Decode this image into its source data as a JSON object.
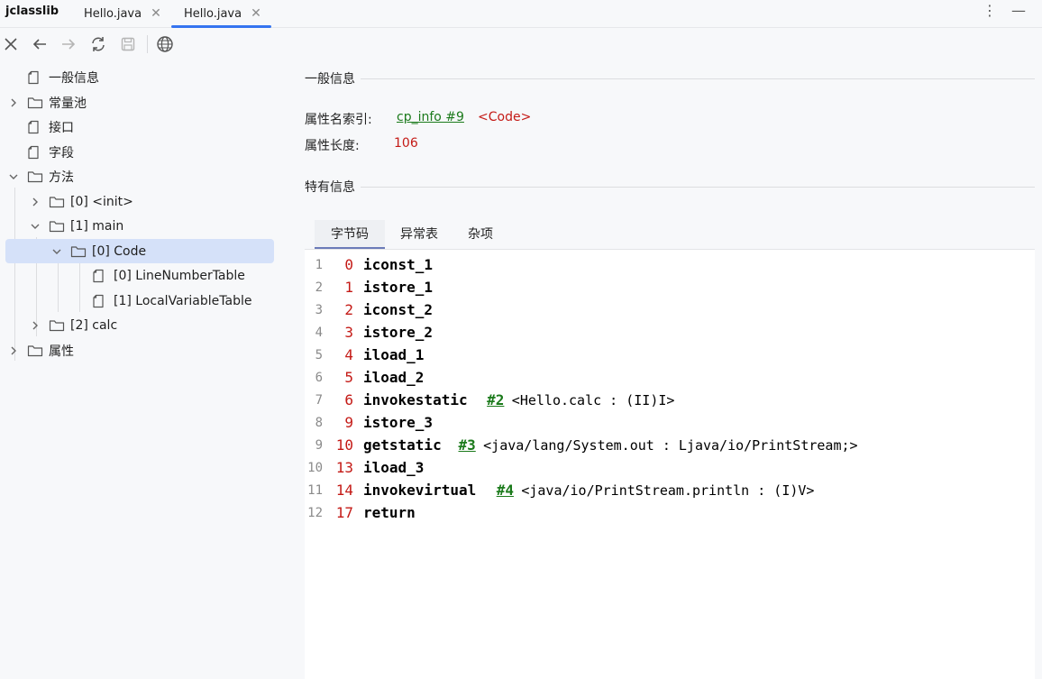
{
  "app": {
    "name": "jclasslib"
  },
  "tabs": [
    {
      "label": "Hello.java",
      "active": false
    },
    {
      "label": "Hello.java",
      "active": true
    }
  ],
  "tab_close_glyph": "✕",
  "window_controls": {
    "more": "⋮",
    "minimize": "—"
  },
  "toolbar": {
    "icons": [
      "close-icon",
      "back-arrow-icon",
      "forward-arrow-icon",
      "refresh-icon",
      "save-icon",
      "globe-icon"
    ]
  },
  "tree": {
    "items": [
      {
        "label": "一般信息",
        "icon": "file-icon"
      },
      {
        "label": "常量池",
        "icon": "folder-icon",
        "state": "collapsed"
      },
      {
        "label": "接口",
        "icon": "file-icon"
      },
      {
        "label": "字段",
        "icon": "file-icon"
      },
      {
        "label": "方法",
        "icon": "folder-icon",
        "state": "expanded"
      },
      {
        "label": "[0] <init>",
        "icon": "folder-icon",
        "state": "collapsed"
      },
      {
        "label": "[1] main",
        "icon": "folder-icon",
        "state": "expanded"
      },
      {
        "label": "[0] Code",
        "icon": "folder-icon",
        "state": "expanded",
        "selected": true
      },
      {
        "label": "[0] LineNumberTable",
        "icon": "file-icon"
      },
      {
        "label": "[1] LocalVariableTable",
        "icon": "file-icon"
      },
      {
        "label": "[2] calc",
        "icon": "folder-icon",
        "state": "collapsed"
      },
      {
        "label": "属性",
        "icon": "folder-icon",
        "state": "collapsed"
      }
    ]
  },
  "general": {
    "title": "一般信息",
    "name_index_label": "属性名索引:",
    "name_index_link": "cp_info #9",
    "name_index_value": "<Code>",
    "length_label": "属性长度:",
    "length_value": "106"
  },
  "specific": {
    "title": "特有信息"
  },
  "subtabs": [
    {
      "label": "字节码",
      "active": true
    },
    {
      "label": "异常表",
      "active": false
    },
    {
      "label": "杂项",
      "active": false
    }
  ],
  "bytecode": [
    {
      "line": "1",
      "offset": "0",
      "op": "iconst_1"
    },
    {
      "line": "2",
      "offset": "1",
      "op": "istore_1"
    },
    {
      "line": "3",
      "offset": "2",
      "op": "iconst_2"
    },
    {
      "line": "4",
      "offset": "3",
      "op": "istore_2"
    },
    {
      "line": "5",
      "offset": "4",
      "op": "iload_1"
    },
    {
      "line": "6",
      "offset": "5",
      "op": "iload_2"
    },
    {
      "line": "7",
      "offset": "6",
      "op": "invokestatic",
      "ref": "#2",
      "comment": "<Hello.calc : (II)I>"
    },
    {
      "line": "8",
      "offset": "9",
      "op": "istore_3"
    },
    {
      "line": "9",
      "offset": "10",
      "op": "getstatic",
      "ref": "#3",
      "comment": "<java/lang/System.out : Ljava/io/PrintStream;>"
    },
    {
      "line": "10",
      "offset": "13",
      "op": "iload_3"
    },
    {
      "line": "11",
      "offset": "14",
      "op": "invokevirtual",
      "ref": "#4",
      "comment": "<java/io/PrintStream.println : (I)V>"
    },
    {
      "line": "12",
      "offset": "17",
      "op": "return"
    }
  ],
  "colors": {
    "accent": "#3574f0",
    "selection": "#d5e1f9",
    "offset": "#c41a16",
    "reference": "#1b7a1b"
  }
}
